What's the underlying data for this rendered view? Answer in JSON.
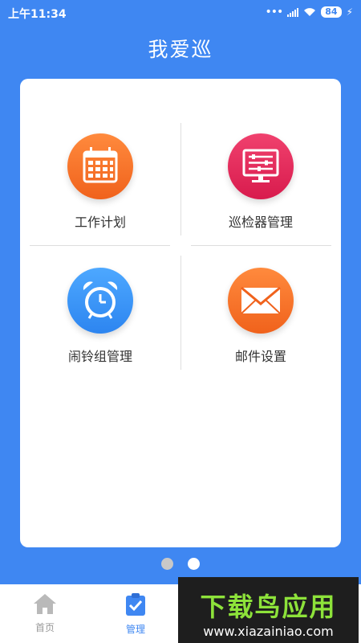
{
  "status_bar": {
    "time": "上午11:34",
    "battery": "84"
  },
  "header": {
    "title": "我爱巡"
  },
  "tiles": [
    {
      "label": "工作计划",
      "icon": "calendar-icon",
      "color": "#F26E25"
    },
    {
      "label": "巡检器管理",
      "icon": "monitor-settings-icon",
      "color": "#E3275A"
    },
    {
      "label": "闹铃组管理",
      "icon": "alarm-clock-icon",
      "color": "#3B95F8"
    },
    {
      "label": "邮件设置",
      "icon": "envelope-icon",
      "color": "#F26E25"
    }
  ],
  "pager": {
    "count": 2,
    "active": 2
  },
  "tabbar": {
    "tabs": [
      {
        "label": "首页",
        "icon": "home-icon",
        "active": false
      },
      {
        "label": "管理",
        "icon": "clipboard-check-icon",
        "active": true
      }
    ]
  },
  "watermark": {
    "title": "下载鸟应用",
    "url": "www.xiazainiao.com"
  }
}
